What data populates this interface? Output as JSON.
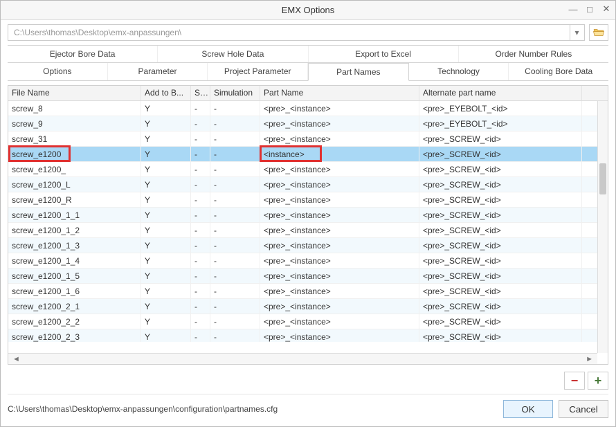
{
  "window": {
    "title": "EMX Options"
  },
  "path": {
    "value": "C:\\Users\\thomas\\Desktop\\emx-anpassungen\\"
  },
  "tabs_top": [
    "Ejector Bore Data",
    "Screw Hole Data",
    "Export to Excel",
    "Order Number Rules"
  ],
  "tabs_bottom": [
    "Options",
    "Parameter",
    "Project Parameter",
    "Part Names",
    "Technology",
    "Cooling Bore Data"
  ],
  "active_tab_bottom": 3,
  "columns": {
    "file_name": "File Name",
    "add_to_bom": "Add to B...",
    "s": "S...",
    "simulation": "Simulation",
    "part_name": "Part Name",
    "alternate": "Alternate part name"
  },
  "rows": [
    {
      "file": "screw_8",
      "add": "Y",
      "s": "-",
      "sim": "-",
      "part": "<pre>_<instance>",
      "alt": "<pre>_EYEBOLT_<id>"
    },
    {
      "file": "screw_9",
      "add": "Y",
      "s": "-",
      "sim": "-",
      "part": "<pre>_<instance>",
      "alt": "<pre>_EYEBOLT_<id>"
    },
    {
      "file": "screw_31",
      "add": "Y",
      "s": "-",
      "sim": "-",
      "part": "<pre>_<instance>",
      "alt": "<pre>_SCREW_<id>"
    },
    {
      "file": "screw_e1200",
      "add": "Y",
      "s": "-",
      "sim": "-",
      "part": "<instance>",
      "alt": "<pre>_SCREW_<id>",
      "sel": true,
      "hl_file": true,
      "hl_part": true
    },
    {
      "file": "screw_e1200_",
      "add": "Y",
      "s": "-",
      "sim": "-",
      "part": "<pre>_<instance>",
      "alt": "<pre>_SCREW_<id>"
    },
    {
      "file": "screw_e1200_L",
      "add": "Y",
      "s": "-",
      "sim": "-",
      "part": "<pre>_<instance>",
      "alt": "<pre>_SCREW_<id>"
    },
    {
      "file": "screw_e1200_R",
      "add": "Y",
      "s": "-",
      "sim": "-",
      "part": "<pre>_<instance>",
      "alt": "<pre>_SCREW_<id>"
    },
    {
      "file": "screw_e1200_1_1",
      "add": "Y",
      "s": "-",
      "sim": "-",
      "part": "<pre>_<instance>",
      "alt": "<pre>_SCREW_<id>"
    },
    {
      "file": "screw_e1200_1_2",
      "add": "Y",
      "s": "-",
      "sim": "-",
      "part": "<pre>_<instance>",
      "alt": "<pre>_SCREW_<id>"
    },
    {
      "file": "screw_e1200_1_3",
      "add": "Y",
      "s": "-",
      "sim": "-",
      "part": "<pre>_<instance>",
      "alt": "<pre>_SCREW_<id>"
    },
    {
      "file": "screw_e1200_1_4",
      "add": "Y",
      "s": "-",
      "sim": "-",
      "part": "<pre>_<instance>",
      "alt": "<pre>_SCREW_<id>"
    },
    {
      "file": "screw_e1200_1_5",
      "add": "Y",
      "s": "-",
      "sim": "-",
      "part": "<pre>_<instance>",
      "alt": "<pre>_SCREW_<id>"
    },
    {
      "file": "screw_e1200_1_6",
      "add": "Y",
      "s": "-",
      "sim": "-",
      "part": "<pre>_<instance>",
      "alt": "<pre>_SCREW_<id>"
    },
    {
      "file": "screw_e1200_2_1",
      "add": "Y",
      "s": "-",
      "sim": "-",
      "part": "<pre>_<instance>",
      "alt": "<pre>_SCREW_<id>"
    },
    {
      "file": "screw_e1200_2_2",
      "add": "Y",
      "s": "-",
      "sim": "-",
      "part": "<pre>_<instance>",
      "alt": "<pre>_SCREW_<id>"
    },
    {
      "file": "screw_e1200_2_3",
      "add": "Y",
      "s": "-",
      "sim": "-",
      "part": "<pre>_<instance>",
      "alt": "<pre>_SCREW_<id>"
    }
  ],
  "actions": {
    "minus": "−",
    "plus": "+"
  },
  "footer": {
    "config_path": "C:\\Users\\thomas\\Desktop\\emx-anpassungen\\configuration\\partnames.cfg",
    "ok": "OK",
    "cancel": "Cancel"
  }
}
